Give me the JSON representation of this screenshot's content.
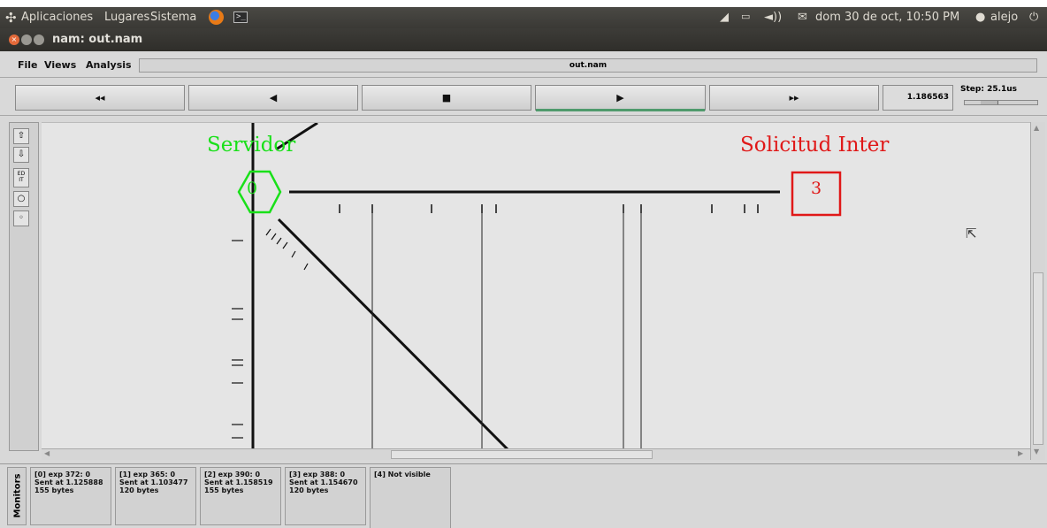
{
  "top_panel": {
    "menus": [
      "Aplicaciones",
      "Lugares",
      "Sistema"
    ],
    "clock": "dom 30 de oct, 10:50 PM",
    "user": "alejo"
  },
  "window": {
    "title": "nam: out.nam"
  },
  "menubar": {
    "file": "File",
    "views": "Views",
    "analysis": "Analysis",
    "filename": "out.nam"
  },
  "transport": {
    "rewind": "◂◂",
    "back": "◀",
    "stop": "■",
    "play": "▶",
    "fast_forward": "▸▸",
    "time": "1.186563",
    "step": "Step: 25.1us"
  },
  "tools": {
    "edit": "ED\nIT"
  },
  "canvas": {
    "node0": {
      "label": "Servidor",
      "id": "0",
      "color": "#19e019"
    },
    "node3": {
      "label": "Solicitud Inter",
      "id": "3",
      "color": "#e01818"
    }
  },
  "monitors": {
    "tab": "Monitors",
    "items": [
      {
        "line1": "[0] exp 372: 0",
        "line2": "Sent at 1.125888",
        "line3": "155 bytes"
      },
      {
        "line1": "[1] exp 365: 0",
        "line2": "Sent at 1.103477",
        "line3": "120 bytes"
      },
      {
        "line1": "[2] exp 390: 0",
        "line2": "Sent at 1.158519",
        "line3": "155 bytes"
      },
      {
        "line1": "[3] exp 388: 0",
        "line2": "Sent at 1.154670",
        "line3": "120 bytes"
      },
      {
        "line1": "[4] Not visible",
        "line2": "",
        "line3": ""
      }
    ]
  }
}
